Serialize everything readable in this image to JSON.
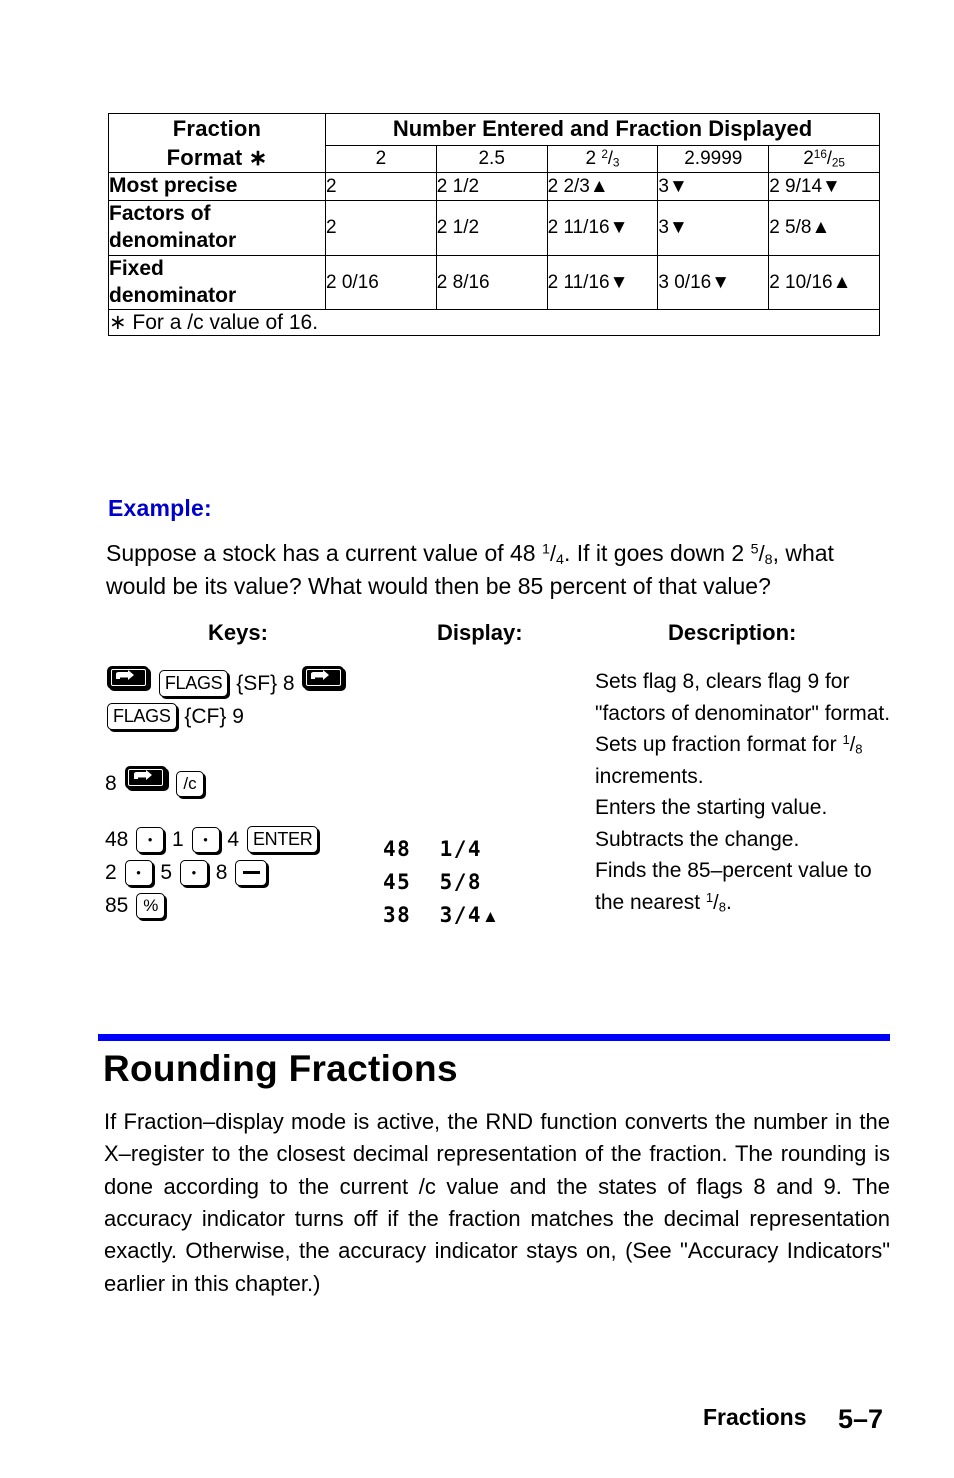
{
  "table": {
    "col_header_left_line1": "Fraction",
    "col_header_left_line2": "Format ∗",
    "main_header": "Number Entered and Fraction Displayed",
    "sub_headers": [
      "2",
      "2.5",
      "2 2/3",
      "2.9999",
      "216/25"
    ],
    "rows": [
      {
        "label_line1": "Most precise",
        "label_line2": "",
        "cells": [
          "2",
          "2 1/2",
          "2 2/3▲",
          "3▼",
          "2 9/14▼"
        ]
      },
      {
        "label_line1": "Factors of",
        "label_line2": "denominator",
        "cells": [
          "2",
          "2 1/2",
          "2 11/16▼",
          "3▼",
          "2 5/8▲"
        ]
      },
      {
        "label_line1": "Fixed",
        "label_line2": "denominator",
        "cells": [
          "2 0/16",
          "2 8/16",
          "2 11/16▼",
          "3 0/16▼",
          "2 10/16▲"
        ]
      }
    ],
    "footnote": "∗ For a /c value of 16."
  },
  "example": {
    "heading": "Example:",
    "body_part1": "Suppose a stock has a current value of 48 ",
    "body_frac1_num": "1",
    "body_frac1_den": "4",
    "body_part2": ". If it goes down 2 ",
    "body_frac2_num": "5",
    "body_frac2_den": "8",
    "body_part3": ", what would be its value? What would then be 85 percent of that value?"
  },
  "steps": {
    "headers": {
      "keys": "Keys:",
      "display": "Display:",
      "description": "Description:"
    },
    "rows": [
      {
        "keys_line1": [
          "shift-key",
          "FLAGS",
          "{SF} 8",
          "shift-key"
        ],
        "keys_line2": [
          "FLAGS",
          "{CF} 9"
        ],
        "display": "",
        "display_indicator": "",
        "description": "Sets flag 8, clears flag 9 for \"factors of denominator\" format."
      },
      {
        "keys_prefix": "8",
        "keys_line1": [
          "shift-key",
          "/c"
        ],
        "display": "",
        "display_indicator": "",
        "description_part1": "Sets up fraction format for ",
        "description_frac_num": "1",
        "description_frac_den": "8",
        "description_part2": " increments."
      },
      {
        "keys_prefix": "48",
        "keys_seq": [
          "dot-key",
          "1",
          "dot-key",
          "4",
          "ENTER"
        ],
        "display": "48  1/4",
        "display_indicator": "",
        "description": "Enters the starting value."
      },
      {
        "keys_prefix": "2",
        "keys_seq": [
          "dot-key",
          "5",
          "dot-key",
          "8",
          "minus-key"
        ],
        "display": "45  5/8",
        "display_indicator": "",
        "description": "Subtracts the change."
      },
      {
        "keys_prefix": "85",
        "keys_seq": [
          "%"
        ],
        "display": "38  3/4",
        "display_indicator": "▲",
        "description_part1": "Finds the 85–percent value to the nearest ",
        "description_frac_num": "1",
        "description_frac_den": "8",
        "description_part2": "."
      }
    ],
    "key_labels": {
      "flags": "FLAGS",
      "sf": "{SF}",
      "cf": "{CF}",
      "enter": "ENTER",
      "percent": "%",
      "over_c": "/c",
      "eight": "8",
      "nine": "9"
    }
  },
  "section": {
    "rule_color": "#0000FF",
    "title": "Rounding Fractions",
    "body": "If Fraction–display mode is active, the RND function converts the number in the X–register to the closest decimal representation of the fraction. The rounding is done according to the current /c value and the states of flags 8 and 9. The accuracy indicator turns off if the fraction matches the decimal representation exactly. Otherwise, the accuracy indicator stays on, (See \"Accuracy Indicators\" earlier in this chapter.)"
  },
  "footer": {
    "chapter_name": "Fractions",
    "page_number": "5–7"
  }
}
